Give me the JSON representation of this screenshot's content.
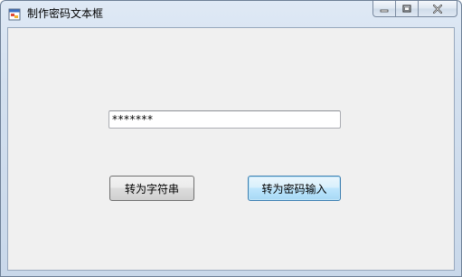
{
  "window": {
    "title": "制作密码文本框"
  },
  "caption_buttons": {
    "minimize_icon": "minimize-icon",
    "maximize_icon": "maximize-icon",
    "close_icon": "close-icon"
  },
  "form": {
    "password_display": "*******",
    "to_string_button": "转为字符串",
    "to_password_button": "转为密码输入"
  },
  "colors": {
    "client_background": "#f0f0f0",
    "titlebar": "#d3e0ef",
    "focused_button_border": "#3c7fb1"
  }
}
